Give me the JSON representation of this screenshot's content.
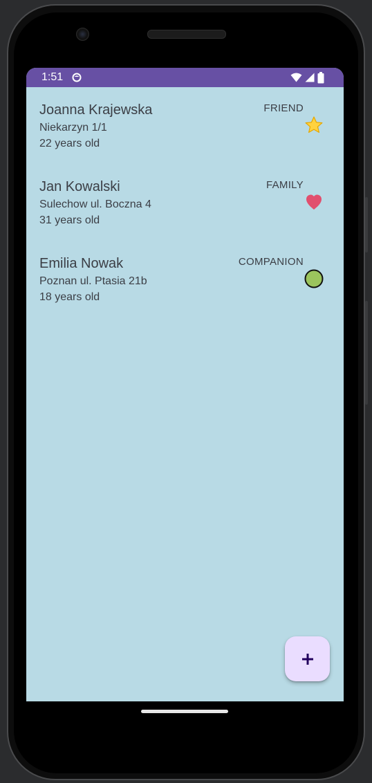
{
  "status_bar": {
    "time": "1:51",
    "background_color": "#6750a4",
    "icons": [
      "notification-icon",
      "wifi-icon",
      "signal-icon",
      "battery-icon"
    ]
  },
  "screen": {
    "background_color": "#b8dae5"
  },
  "contacts": [
    {
      "name": "Joanna Krajewska",
      "address": "Niekarzyn 1/1",
      "age": "22 years old",
      "type": "FRIEND",
      "icon": "star-icon"
    },
    {
      "name": "Jan Kowalski",
      "address": "Sulechow ul. Boczna 4",
      "age": "31 years old",
      "type": "FAMILY",
      "icon": "heart-icon"
    },
    {
      "name": "Emilia Nowak",
      "address": "Poznan ul. Ptasia 21b",
      "age": "18 years old",
      "type": "COMPANION",
      "icon": "circle-icon"
    }
  ],
  "fab": {
    "symbol": "+",
    "icon": "plus-icon",
    "background_color": "#eaddff"
  }
}
